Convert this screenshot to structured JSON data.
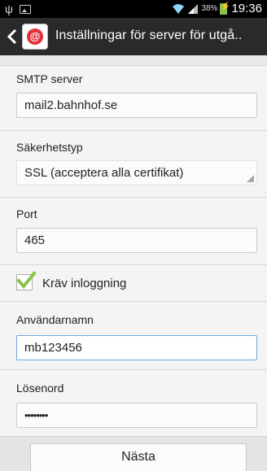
{
  "status_bar": {
    "usb_icon": "usb-icon",
    "picture_icon": "picture-icon",
    "battery_percent": "38%",
    "time": "19:36",
    "battery_color": "#8bc34a"
  },
  "action_bar": {
    "title": "Inställningar för server för utgå.."
  },
  "smtp": {
    "label": "SMTP server",
    "value": "mail2.bahnhof.se"
  },
  "security": {
    "label": "Säkerhetstyp",
    "value": "SSL (acceptera alla certifikat)"
  },
  "port": {
    "label": "Port",
    "value": "465"
  },
  "require_login": {
    "label": "Kräv inloggning",
    "checked": true,
    "check_color": "#8bc34a"
  },
  "username": {
    "label": "Användarnamn",
    "value": "mb123456"
  },
  "password": {
    "label": "Lösenord",
    "value": "••••••••"
  },
  "next_button": {
    "label": "Nästa"
  }
}
